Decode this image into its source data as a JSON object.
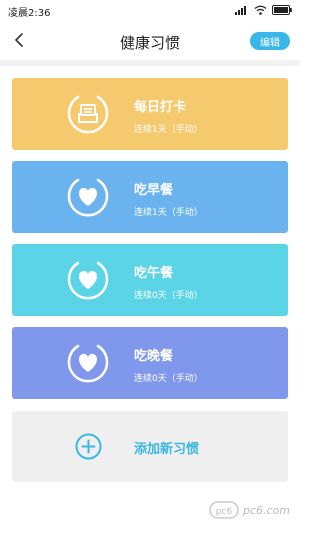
{
  "status_bar": {
    "time": "凌晨2:36",
    "icons": [
      "signal-icon",
      "wifi-icon",
      "battery-icon"
    ]
  },
  "navbar": {
    "back_icon": "chevron-left-icon",
    "title": "健康习惯",
    "edit_label": "编辑"
  },
  "habits": [
    {
      "title": "每日打卡",
      "subtitle": "连续1天（手动）",
      "icon": "calendar-check-icon",
      "color": "#f5c96e"
    },
    {
      "title": "吃早餐",
      "subtitle": "连续1天（手动）",
      "icon": "heart-ring-icon",
      "color": "#6bb3ee"
    },
    {
      "title": "吃午餐",
      "subtitle": "连续0天（手动）",
      "icon": "heart-ring-icon",
      "color": "#5ad4e6"
    },
    {
      "title": "吃晚餐",
      "subtitle": "连续0天（手动）",
      "icon": "heart-ring-icon",
      "color": "#7f98ec"
    }
  ],
  "add_habit": {
    "label": "添加新习惯",
    "icon": "plus-circle-icon",
    "color": "#3ab7e3"
  },
  "watermark": {
    "text": "pc6.com",
    "icon": "pc6-logo"
  }
}
